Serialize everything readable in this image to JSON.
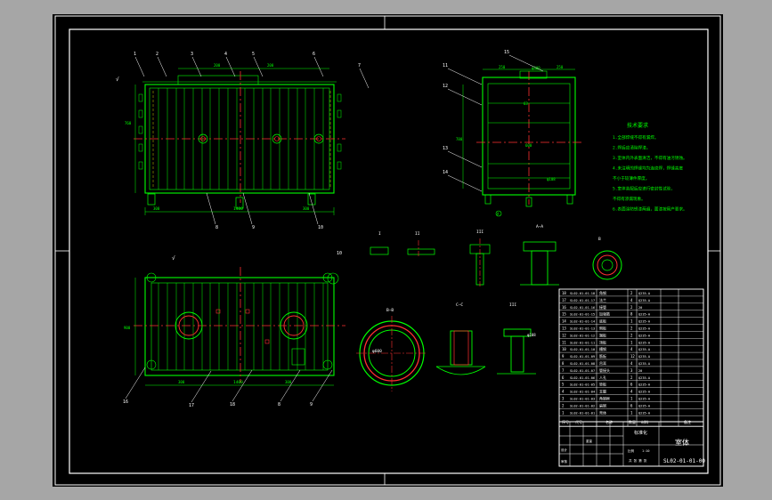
{
  "drawing": {
    "title_cn": "室体",
    "drawing_no": "SL02-01-01-00",
    "scale_label": "1:10",
    "view_labels": {
      "a": "A",
      "b": "B",
      "sec_aa": "A—A",
      "sec_bb": "B—B",
      "sec_cc": "C—C",
      "detail_i": "I",
      "detail_ii": "II",
      "detail_iii": "III"
    },
    "dims": {
      "len_main": "1400",
      "len_sub": "900",
      "h_main": "760",
      "side_w": "600",
      "side_h": "780",
      "d_bottom": "1600",
      "d_300": "300",
      "d_200": "200",
      "d_250": "250",
      "d_150": "150",
      "d_63": "63",
      "d_90": "90"
    },
    "balloons": [
      "1",
      "2",
      "3",
      "4",
      "5",
      "6",
      "7",
      "8",
      "9",
      "10",
      "11",
      "12",
      "13",
      "14",
      "15",
      "16",
      "17",
      "18"
    ],
    "tech_req_title": "技术要求",
    "tech_req_lines": [
      "1.全部焊缝不得有漏焊。",
      "2.焊后应清除焊渣。",
      "3.室体内外表面清洁，不得有油污锈蚀。",
      "4.未注明的焊缝均为连续焊，焊缝高度",
      "  不小于较薄件厚度。",
      "5.室体装配后应进行密封性试验，",
      "  不得有渗漏现象。",
      "6.表面涂防锈漆两遍，面漆按用户要求。"
    ],
    "parts_header": {
      "no": "序号",
      "code": "代号",
      "name": "名称",
      "qty": "数量",
      "material": "材料",
      "note": "备注"
    },
    "parts": [
      {
        "no": "18",
        "code": "SL02-01-01-18",
        "name": "角钢",
        "qty": "2",
        "material": "Q235-A"
      },
      {
        "no": "17",
        "code": "SL02-01-01-17",
        "name": "法兰",
        "qty": "4",
        "material": "Q235-A"
      },
      {
        "no": "16",
        "code": "SL02-01-01-16",
        "name": "接管",
        "qty": "2",
        "material": "20"
      },
      {
        "no": "15",
        "code": "SL02-01-01-15",
        "name": "加强筋",
        "qty": "8",
        "material": "Q235-A"
      },
      {
        "no": "14",
        "code": "SL02-01-01-14",
        "name": "底板",
        "qty": "1",
        "material": "Q235-A"
      },
      {
        "no": "13",
        "code": "SL02-01-01-13",
        "name": "侧板",
        "qty": "2",
        "material": "Q235-A"
      },
      {
        "no": "12",
        "code": "SL02-01-01-12",
        "name": "端板",
        "qty": "2",
        "material": "Q235-A"
      },
      {
        "no": "11",
        "code": "SL02-01-01-11",
        "name": "顶板",
        "qty": "1",
        "material": "Q235-A"
      },
      {
        "no": "10",
        "code": "SL02-01-01-10",
        "name": "槽钢",
        "qty": "4",
        "material": "Q235-A"
      },
      {
        "no": "9",
        "code": "SL02-01-01-09",
        "name": "筋板",
        "qty": "12",
        "material": "Q235-A"
      },
      {
        "no": "8",
        "code": "SL02-01-01-08",
        "name": "吊耳",
        "qty": "4",
        "material": "Q235-A"
      },
      {
        "no": "7",
        "code": "SL02-01-01-07",
        "name": "管接头",
        "qty": "3",
        "material": "20"
      },
      {
        "no": "6",
        "code": "SL02-01-01-06",
        "name": "人孔",
        "qty": "2",
        "material": "Q235-A"
      },
      {
        "no": "5",
        "code": "SL02-01-01-05",
        "name": "垫板",
        "qty": "6",
        "material": "Q235-A"
      },
      {
        "no": "4",
        "code": "SL02-01-01-04",
        "name": "支腿",
        "qty": "4",
        "material": "Q235-A"
      },
      {
        "no": "3",
        "code": "SL02-01-01-03",
        "name": "角钢框",
        "qty": "1",
        "material": "Q235-A"
      },
      {
        "no": "2",
        "code": "SL02-01-01-02",
        "name": "扁钢",
        "qty": "6",
        "material": "Q235-A"
      },
      {
        "no": "1",
        "code": "SL02-01-01-01",
        "name": "壳体",
        "qty": "1",
        "material": "Q235-A"
      }
    ],
    "title_block": {
      "label_design": "设计",
      "label_check": "审核",
      "label_scale": "比例",
      "label_weight": "重量",
      "label_sheet": "共  张  第  张",
      "label_material": "材料",
      "org": "标准化"
    }
  },
  "colors": {
    "background": "#a6a6a6",
    "sheet": "#000000",
    "outline": "#ffffff",
    "geometry": "#00ff00",
    "center": "#ff3030",
    "hidden": "#ffff00",
    "section": "#ff00ff"
  }
}
